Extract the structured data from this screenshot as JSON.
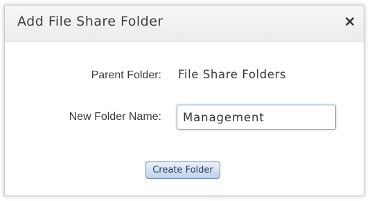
{
  "dialog": {
    "title": "Add File Share Folder",
    "close_icon": "close-icon"
  },
  "form": {
    "parent_folder_label": "Parent Folder:",
    "parent_folder_value": "File Share Folders",
    "new_folder_label": "New Folder Name:",
    "new_folder_value": "Management",
    "create_button_label": "Create Folder"
  },
  "colors": {
    "accent_border": "#8aa3c0",
    "button_gradient_top": "#e9f1fb",
    "button_gradient_bottom": "#bfd2ea"
  }
}
